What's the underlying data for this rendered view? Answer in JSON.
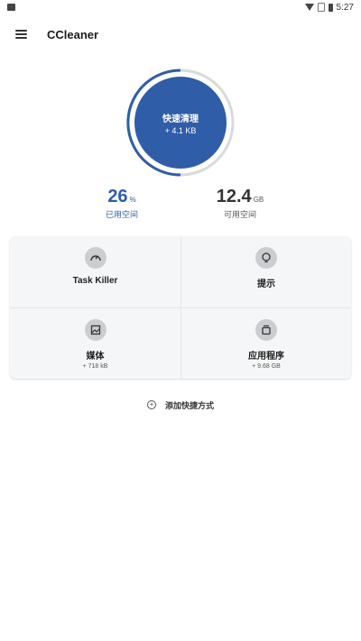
{
  "status_bar": {
    "time": "5:27",
    "icons": [
      "image-icon",
      "wifi-icon",
      "no-sim-icon",
      "battery-icon"
    ]
  },
  "app_bar": {
    "title": "CCleaner",
    "menu_icon": "hamburger-menu-icon"
  },
  "quick_clean": {
    "label": "快速清理",
    "size": "+ 4.1 KB",
    "color": "#2f5da8"
  },
  "storage": {
    "used": {
      "value": "26",
      "unit": "%",
      "caption": "已用空间"
    },
    "free": {
      "value": "12.4",
      "unit": "GB",
      "caption": "可用空间"
    }
  },
  "tiles": [
    {
      "label": "Task Killer",
      "sub": "",
      "icon": "speedometer-icon"
    },
    {
      "label": "提示",
      "sub": "",
      "icon": "lightbulb-icon"
    },
    {
      "label": "媒体",
      "sub": "+ 718 kB",
      "icon": "image-icon"
    },
    {
      "label": "应用程序",
      "sub": "+ 9.68 GB",
      "icon": "apps-stack-icon"
    }
  ],
  "add_shortcut": {
    "label": "添加快捷方式",
    "icon": "plus-circle-icon"
  }
}
